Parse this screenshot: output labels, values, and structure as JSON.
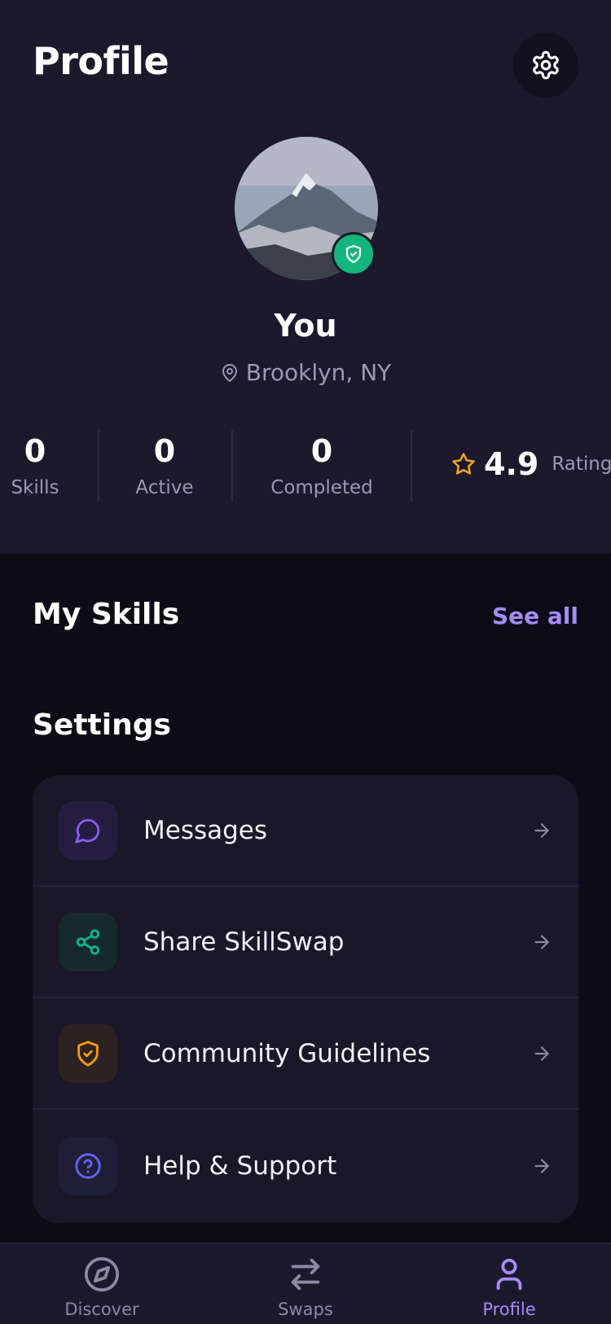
{
  "header": {
    "title": "Profile"
  },
  "profile": {
    "name": "You",
    "location": "Brooklyn, NY",
    "verified": true
  },
  "stats": [
    {
      "value": "0",
      "label": "Skills"
    },
    {
      "value": "0",
      "label": "Active"
    },
    {
      "value": "0",
      "label": "Completed"
    }
  ],
  "rating": {
    "value": "4.9",
    "label": "Rating"
  },
  "my_skills": {
    "title": "My Skills",
    "see_all": "See all"
  },
  "settings": {
    "title": "Settings",
    "items": [
      {
        "label": "Messages",
        "icon": "message-icon",
        "color": "#8b5cf6"
      },
      {
        "label": "Share SkillSwap",
        "icon": "share-icon",
        "color": "#10b981"
      },
      {
        "label": "Community Guidelines",
        "icon": "shield-check-icon",
        "color": "#f59e0b"
      },
      {
        "label": "Help & Support",
        "icon": "help-icon",
        "color": "#6366f1"
      }
    ]
  },
  "nav": {
    "items": [
      {
        "label": "Discover",
        "icon": "compass-icon",
        "active": false
      },
      {
        "label": "Swaps",
        "icon": "swap-arrows-icon",
        "active": false
      },
      {
        "label": "Profile",
        "icon": "user-icon",
        "active": true
      }
    ]
  },
  "colors": {
    "background": "#0d0b16",
    "header_bg": "#1c192c",
    "accent": "#a78bfa",
    "verified": "#13b57d",
    "star": "#f5a623"
  }
}
